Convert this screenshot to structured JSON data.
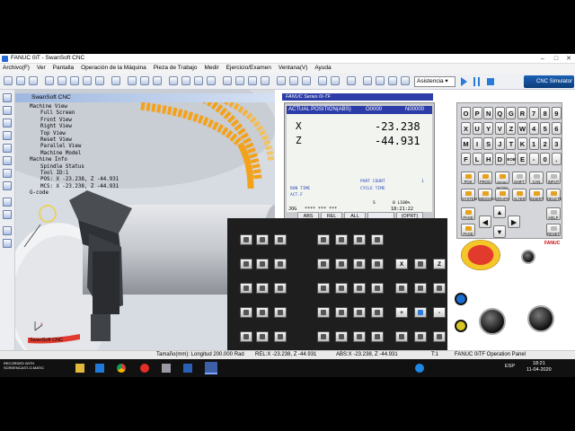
{
  "window": {
    "title": "FANUC 0iT - SwanSoft CNC"
  },
  "menu": [
    "Archivo(F)",
    "Ver",
    "Pantalla",
    "Operación de la Máquina",
    "Pieza de Trabajo",
    "Medir",
    "Ejercicio/Examen",
    "Ventana(V)",
    "Ayuda"
  ],
  "toolbar": {
    "mode_select": "Asistencia",
    "logo": "CNC Simulator"
  },
  "view": {
    "title": "SwanSoft CNC",
    "footer": "SwanSoft CNC",
    "tree": [
      "Machine View",
      "Full Screen",
      "Front View",
      "Right View",
      "Top View",
      "Reset View",
      "Parallel View",
      "Machine Model",
      "Machine Info",
      "Spindle Status",
      "Tool ID:1",
      "POS: X -23.238, Z -44.931",
      "MCS: X -23.238, Z -44.931",
      "G-code"
    ]
  },
  "crt": {
    "series": "FANUC Series 0i-TF",
    "header": "ACTUAL POSITION(ABS)",
    "prog": "O0000",
    "seq": "N00000",
    "x_label": "X",
    "x_value": "-23.238",
    "z_label": "Z",
    "z_value": "-44.931",
    "run_time": "RUN TIME",
    "act_f": "ACT.F",
    "part_count": "PART COUNT",
    "cycle_time": "CYCLE TIME",
    "s_label": "S",
    "t_value": "0 L100%",
    "mode": "JOG",
    "stars": "****  ***  ***",
    "clock": "18:21:22",
    "softkeys": [
      "ABS",
      "REL",
      "ALL",
      "",
      "(OPRT)"
    ]
  },
  "mdi": {
    "keys": [
      [
        "O",
        "P",
        "N",
        "Q",
        "G",
        "R",
        "7",
        "8",
        "9"
      ],
      [
        "X",
        "U",
        "Y",
        "V",
        "Z",
        "W",
        "4",
        "5",
        "6"
      ],
      [
        "M",
        "I",
        "S",
        "J",
        "T",
        "K",
        "1",
        "2",
        "3"
      ],
      [
        "F",
        "L",
        "H",
        "D",
        "EOB",
        "E",
        "-",
        "0",
        "."
      ]
    ],
    "func_row1": [
      "POS",
      "PROG",
      "OFFSET SETTING",
      "SHIFT",
      "CAN",
      "INPUT"
    ],
    "func_row2": [
      "SYSTEM",
      "MESSAGE",
      "GRAPH",
      "ALTER",
      "INSERT",
      "DELETE"
    ],
    "page_up": "PAGE",
    "page_down": "PAGE",
    "help": "HELP",
    "reset": "RESET"
  },
  "opanel": {
    "axis_keys": [
      "X",
      "Z",
      "+",
      "-",
      "1",
      "5",
      "4",
      "6"
    ]
  },
  "brand": "FANUC",
  "status_bar": {
    "size": "Tamaño(mm): Longitud 200.000 Rad",
    "rel": "REL:X -23.238, Z -44.931",
    "abs": "ABS:X -23.238, Z -44.931",
    "tool": "T:1",
    "panel": "FANUC 0iTF Operation Panel"
  },
  "taskbar": {
    "time": "18:21",
    "date": "11-04-2020",
    "lang": "ESP",
    "recorder": "RECORDED WITH SCREENCAST-O-MATIC"
  },
  "colors": {
    "crt_header": "#2c3ca8",
    "estop": "#e23a2c",
    "menu_bg": "#f3f3f3",
    "workpiece": "#c5c8cd"
  }
}
